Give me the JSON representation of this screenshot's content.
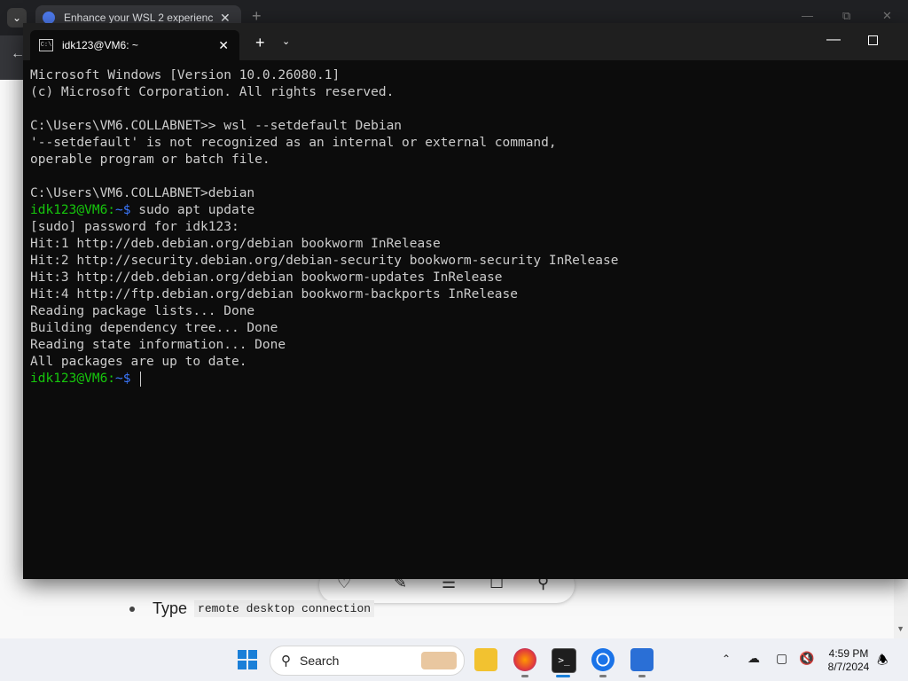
{
  "browser": {
    "tab_title": "Enhance your WSL 2 experienc",
    "article_bullet_text": "Type",
    "article_bullet_code": "remote desktop connection"
  },
  "terminal": {
    "tab_title": "idk123@VM6: ~",
    "lines": [
      {
        "type": "text",
        "text": "Microsoft Windows [Version 10.0.26080.1]"
      },
      {
        "type": "text",
        "text": "(c) Microsoft Corporation. All rights reserved."
      },
      {
        "type": "blank",
        "text": ""
      },
      {
        "type": "text",
        "text": "C:\\Users\\VM6.COLLABNET>> wsl --setdefault Debian"
      },
      {
        "type": "text",
        "text": "'--setdefault' is not recognized as an internal or external command,"
      },
      {
        "type": "text",
        "text": "operable program or batch file."
      },
      {
        "type": "blank",
        "text": ""
      },
      {
        "type": "text",
        "text": "C:\\Users\\VM6.COLLABNET>debian"
      },
      {
        "type": "prompt",
        "prompt": "idk123@VM6:",
        "path": "~$",
        "text": " sudo apt update"
      },
      {
        "type": "text",
        "text": "[sudo] password for idk123:"
      },
      {
        "type": "text",
        "text": "Hit:1 http://deb.debian.org/debian bookworm InRelease"
      },
      {
        "type": "text",
        "text": "Hit:2 http://security.debian.org/debian-security bookworm-security InRelease"
      },
      {
        "type": "text",
        "text": "Hit:3 http://deb.debian.org/debian bookworm-updates InRelease"
      },
      {
        "type": "text",
        "text": "Hit:4 http://ftp.debian.org/debian bookworm-backports InRelease"
      },
      {
        "type": "text",
        "text": "Reading package lists... Done"
      },
      {
        "type": "text",
        "text": "Building dependency tree... Done"
      },
      {
        "type": "text",
        "text": "Reading state information... Done"
      },
      {
        "type": "text",
        "text": "All packages are up to date."
      },
      {
        "type": "prompt",
        "prompt": "idk123@VM6:",
        "path": "~$",
        "text": " ",
        "cursor": true
      }
    ]
  },
  "taskbar": {
    "search_label": "Search",
    "clock_time": "4:59 PM",
    "clock_date": "8/7/2024"
  },
  "colors": {
    "prompt_green": "#16c60c",
    "terminal_bg": "#0c0c0c",
    "terminal_text": "#cccccc"
  }
}
